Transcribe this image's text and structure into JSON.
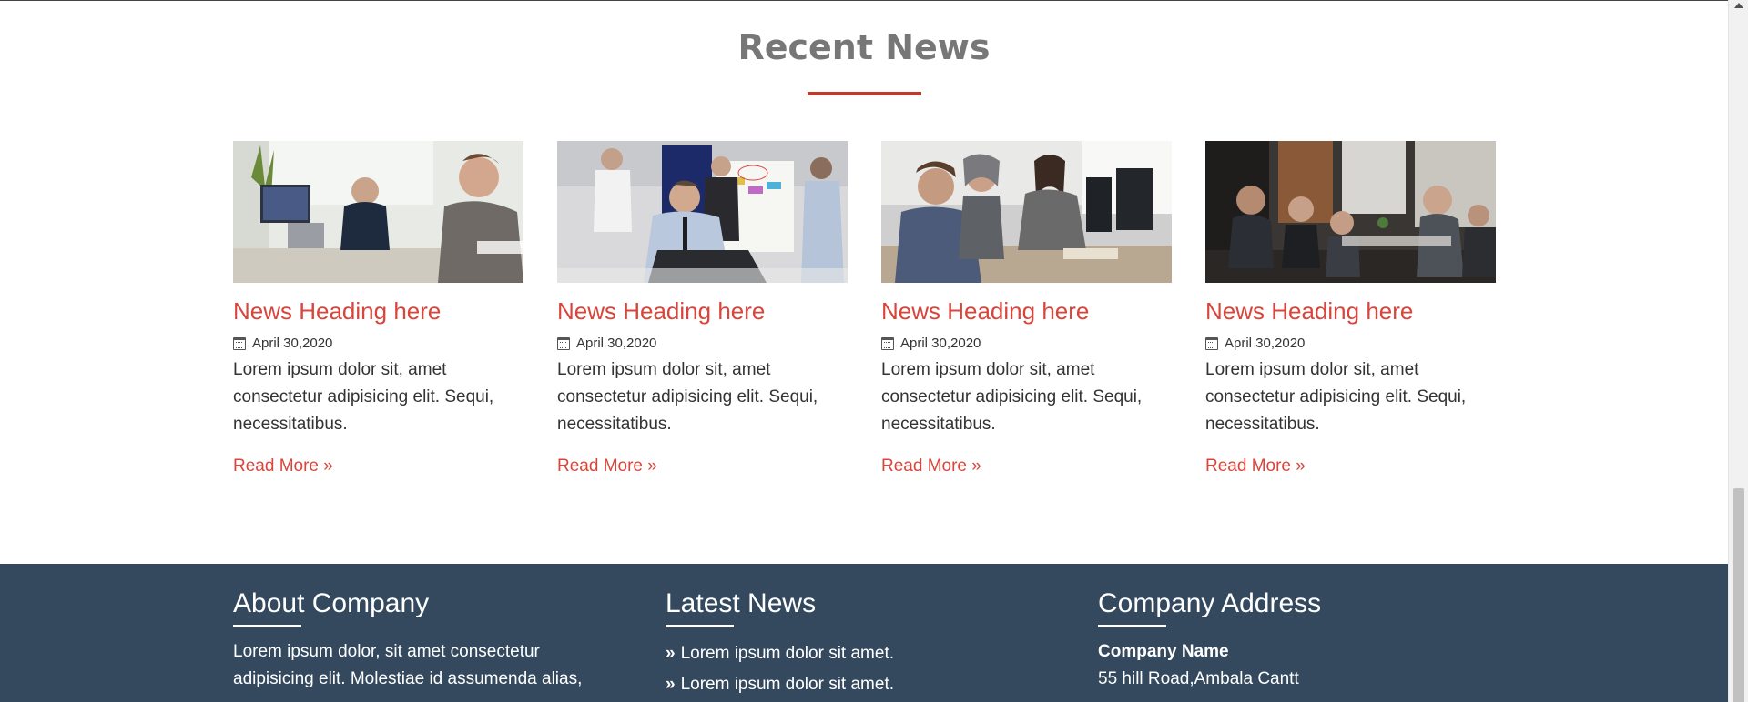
{
  "recent_news": {
    "title": "Recent News",
    "cards": [
      {
        "heading": "News Heading here",
        "date": "April 30,2020",
        "text": "Lorem ipsum dolor sit, amet consectetur adipisicing elit. Sequi, necessitatibus.",
        "read_more": "Read More »"
      },
      {
        "heading": "News Heading here",
        "date": "April 30,2020",
        "text": "Lorem ipsum dolor sit, amet consectetur adipisicing elit. Sequi, necessitatibus.",
        "read_more": "Read More »"
      },
      {
        "heading": "News Heading here",
        "date": "April 30,2020",
        "text": "Lorem ipsum dolor sit, amet consectetur adipisicing elit. Sequi, necessitatibus.",
        "read_more": "Read More »"
      },
      {
        "heading": "News Heading here",
        "date": "April 30,2020",
        "text": "Lorem ipsum dolor sit, amet consectetur adipisicing elit. Sequi, necessitatibus.",
        "read_more": "Read More »"
      }
    ]
  },
  "footer": {
    "about": {
      "title": "About Company",
      "text": "Lorem ipsum dolor, sit amet consectetur adipisicing elit. Molestiae id assumenda alias,"
    },
    "latest_news": {
      "title": "Latest News",
      "items": [
        "Lorem ipsum dolor sit amet.",
        "Lorem ipsum dolor sit amet."
      ]
    },
    "address": {
      "title": "Company Address",
      "company_name": "Company Name",
      "line1": "55 hill Road,Ambala Cantt"
    }
  },
  "colors": {
    "accent": "#d9453b",
    "footer_bg": "#34495e",
    "title_gray": "#777777"
  }
}
